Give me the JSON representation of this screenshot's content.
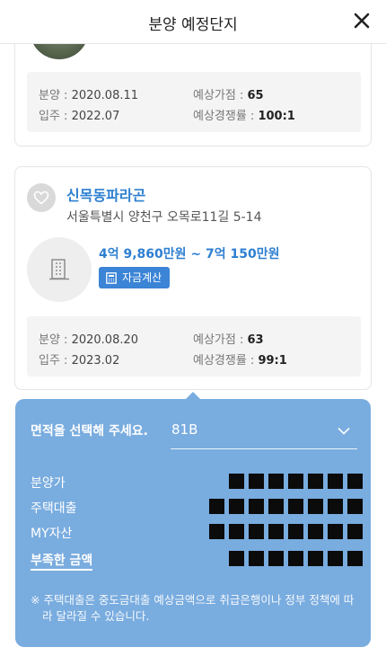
{
  "header": {
    "title": "분양 예정단지",
    "close_icon": "close-icon"
  },
  "cards": [
    {
      "stats": {
        "sale_label": "분양 : ",
        "sale_value": "2020.08.11",
        "move_label": "입주 : ",
        "move_value": "2022.07",
        "points_label": "예상가점 : ",
        "points_value": "65",
        "competition_label": "예상경쟁률 : ",
        "competition_value": "100:1"
      }
    },
    {
      "name": "신목동파라곤",
      "address": "서울특별시 양천구 오목로11길 5-14",
      "price_range": "4억 9,860만원 ~ 7억 150만원",
      "calc_button": "자금계산",
      "stats": {
        "sale_label": "분양 : ",
        "sale_value": "2020.08.20",
        "move_label": "입주 : ",
        "move_value": "2023.02",
        "points_label": "예상가점 : ",
        "points_value": "63",
        "competition_label": "예상경쟁률 : ",
        "competition_value": "99:1"
      }
    }
  ],
  "calculator": {
    "area_prompt": "면적을 선택해 주세요.",
    "area_selected": "81B",
    "rows": [
      {
        "label": "분양가"
      },
      {
        "label": "주택대출"
      },
      {
        "label": "MY자산"
      },
      {
        "label": "부족한 금액"
      }
    ],
    "note": "※ 주택대출은 중도금대출 예상금액으로 취급은행이나 정부 정책에 따라 달라질 수 있습니다."
  },
  "colors": {
    "accent": "#2d7fd1",
    "panel": "#79acdf",
    "button": "#3b84d6"
  }
}
